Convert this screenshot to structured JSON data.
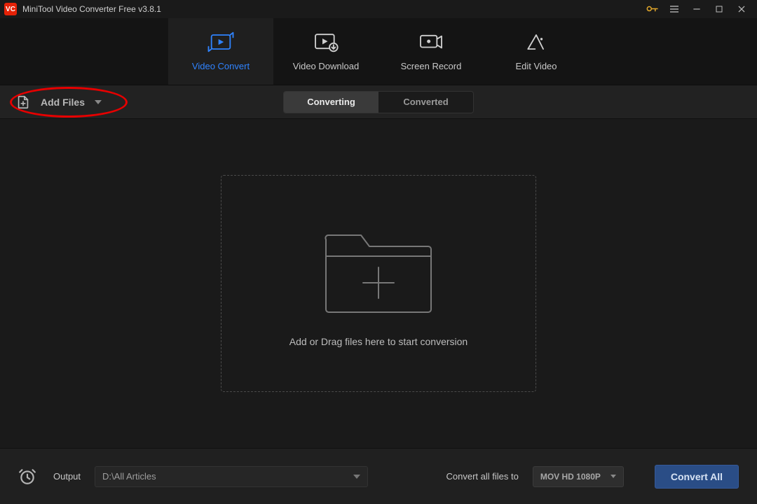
{
  "titlebar": {
    "app_abbrev": "VC",
    "title": "MiniTool Video Converter Free v3.8.1"
  },
  "tabs": {
    "video_convert": "Video Convert",
    "video_download": "Video Download",
    "screen_record": "Screen Record",
    "edit_video": "Edit Video"
  },
  "toolbar": {
    "add_files": "Add Files"
  },
  "subtabs": {
    "converting": "Converting",
    "converted": "Converted"
  },
  "drop": {
    "hint": "Add or Drag files here to start conversion"
  },
  "bottom": {
    "output_label": "Output",
    "output_path": "D:\\All Articles",
    "convert_all_label": "Convert all files to",
    "format": "MOV HD 1080P",
    "convert_all_btn": "Convert All"
  }
}
